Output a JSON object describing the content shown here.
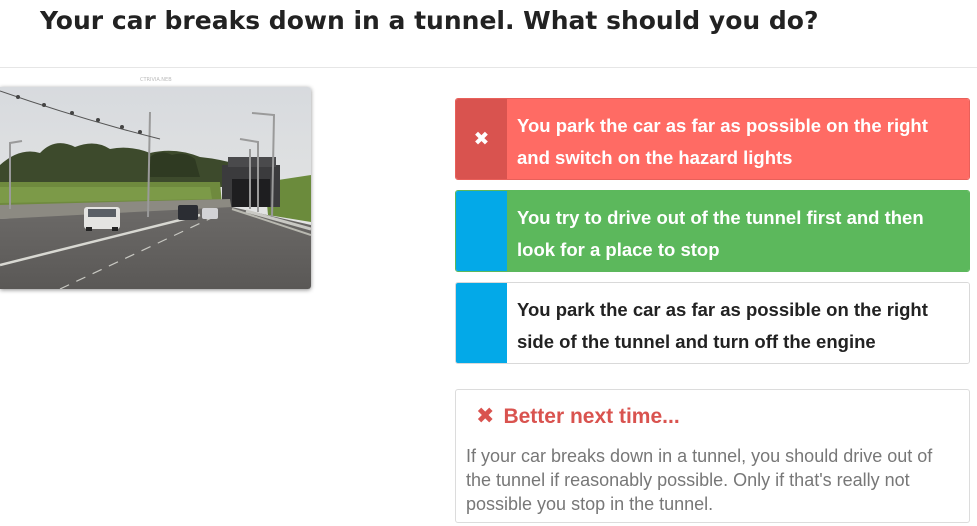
{
  "question": {
    "title": "Your car breaks down in a tunnel. What should you do?"
  },
  "image": {
    "credit": "CTRIVIA.NEB",
    "description_icon": "road-tunnel-photo"
  },
  "answers": [
    {
      "text": "You park the car as far as possible on the right and switch on the hazard lights",
      "status": "wrong",
      "marker_icon": "close-icon",
      "colors": {
        "marker": "#d9534f",
        "body": "#ff6b64",
        "text": "#ffffff"
      }
    },
    {
      "text": "You try to drive out of the tunnel first and then look for a place to stop",
      "status": "correct",
      "marker_icon": "none",
      "colors": {
        "marker": "#03a9e8",
        "body": "#5cb85c",
        "text": "#ffffff"
      }
    },
    {
      "text": "You park the car as far as possible on the right side of the tunnel and turn off the engine",
      "status": "neutral",
      "marker_icon": "none",
      "colors": {
        "marker": "#03a9e8",
        "body": "#ffffff",
        "text": "#222222"
      }
    }
  ],
  "feedback": {
    "icon": "close-icon",
    "title": "Better next time...",
    "body": "If your car breaks down in a tunnel, you should drive out of the tunnel if reasonably possible. Only if that's really not possible you stop in the tunnel.",
    "color": "#d9534f"
  }
}
